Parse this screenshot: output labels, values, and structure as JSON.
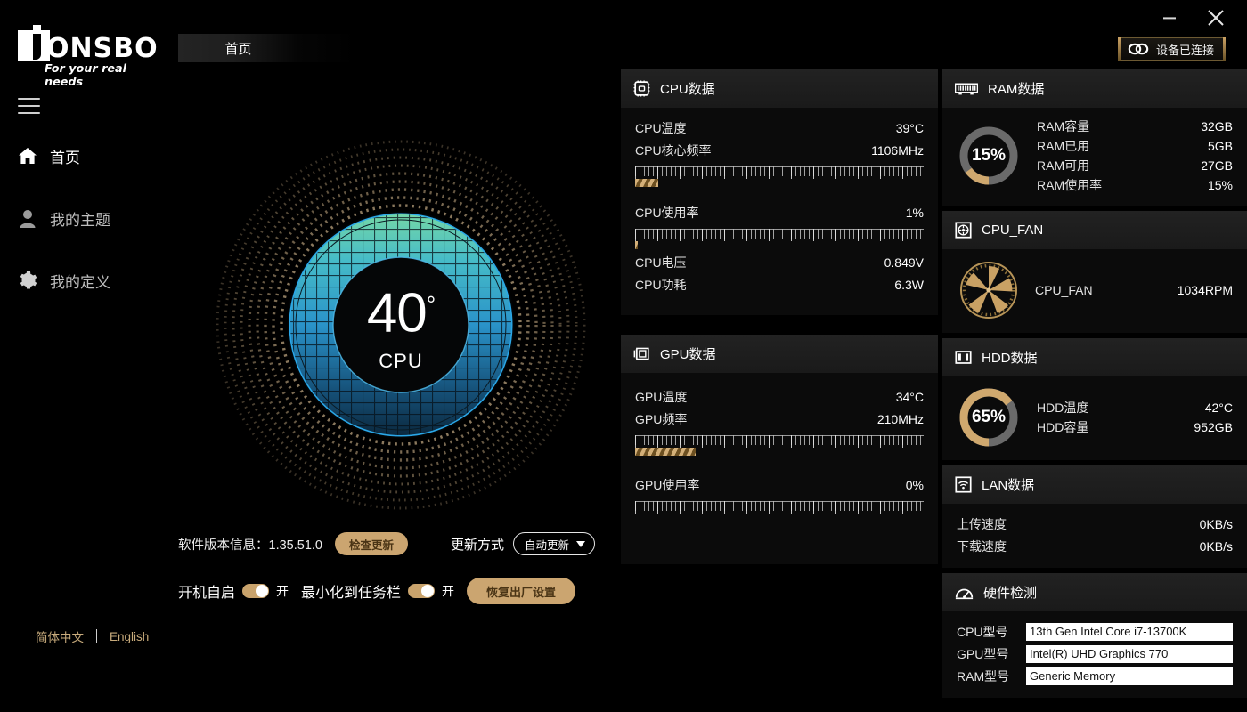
{
  "window": {
    "minimize_label": "minimize",
    "close_label": "close"
  },
  "brand": {
    "name": "ONSBO",
    "tagline": "For your real needs"
  },
  "connection": {
    "status_text": "设备已连接",
    "icon": "chain-link-icon"
  },
  "tabs": [
    {
      "label": "首页",
      "active": true
    }
  ],
  "sidebar": {
    "items": [
      {
        "label": "首页",
        "icon": "home-icon",
        "active": true
      },
      {
        "label": "我的主题",
        "icon": "user-icon",
        "active": false
      },
      {
        "label": "我的定义",
        "icon": "gear-icon",
        "active": false
      }
    ],
    "languages": [
      {
        "label": "简体中文"
      },
      {
        "label": "English"
      }
    ]
  },
  "gauge": {
    "value": "40",
    "degree_symbol": "°",
    "label": "CPU",
    "ring_color": "#2aa7e8",
    "mesh_top_color": "#6fd6a8"
  },
  "settings": {
    "version_label": "软件版本信息：1.35.51.0",
    "check_update_label": "检查更新",
    "update_mode_label": "更新方式",
    "update_mode_value": "自动更新",
    "autostart_label": "开机自启",
    "autostart_state": "开",
    "minimize_tray_label": "最小化到任务栏",
    "minimize_tray_state": "开",
    "restore_label": "恢复出厂设置",
    "accent_gold": "#cba570"
  },
  "panels": {
    "cpu": {
      "title": "CPU数据",
      "icon": "cpu-chip-icon",
      "rows": [
        {
          "key": "CPU温度",
          "value": "39°C"
        },
        {
          "key": "CPU核心频率",
          "value": "1106MHz"
        }
      ],
      "meter1_pct": 8,
      "rows2": [
        {
          "key": "CPU使用率",
          "value": "1%"
        }
      ],
      "meter2_pct": 1,
      "rows3": [
        {
          "key": "CPU电压",
          "value": "0.849V"
        },
        {
          "key": "CPU功耗",
          "value": "6.3W"
        }
      ]
    },
    "gpu": {
      "title": "GPU数据",
      "icon": "gpu-card-icon",
      "rows": [
        {
          "key": "GPU温度",
          "value": "34°C"
        },
        {
          "key": "GPU频率",
          "value": "210MHz"
        }
      ],
      "meter1_pct": 21,
      "rows2": [
        {
          "key": "GPU使用率",
          "value": "0%"
        }
      ],
      "meter2_pct": 0
    },
    "ram": {
      "title": "RAM数据",
      "icon": "ram-stick-icon",
      "donut_pct": 15,
      "donut_text": "15%",
      "donut_fill": "#cfa86e",
      "donut_track": "#6a6a6a",
      "rows": [
        {
          "key": "RAM容量",
          "value": "32GB"
        },
        {
          "key": "RAM已用",
          "value": "5GB"
        },
        {
          "key": "RAM可用",
          "value": "27GB"
        },
        {
          "key": "RAM使用率",
          "value": "15%"
        }
      ]
    },
    "cpu_fan": {
      "title": "CPU_FAN",
      "icon": "fan-square-icon",
      "rows": [
        {
          "key": "CPU_FAN",
          "value": "1034RPM"
        }
      ]
    },
    "hdd": {
      "title": "HDD数据",
      "icon": "hdd-icon",
      "donut_pct": 65,
      "donut_text": "65%",
      "donut_fill": "#cfa86e",
      "donut_track": "#6a6a6a",
      "rows": [
        {
          "key": "HDD温度",
          "value": "42°C"
        },
        {
          "key": "HDD容量",
          "value": "952GB"
        }
      ]
    },
    "lan": {
      "title": "LAN数据",
      "icon": "wifi-icon",
      "rows": [
        {
          "key": "上传速度",
          "value": "0KB/s"
        },
        {
          "key": "下载速度",
          "value": "0KB/s"
        }
      ]
    },
    "hardware": {
      "title": "硬件检测",
      "icon": "gauge-meter-icon",
      "rows": [
        {
          "key": "CPU型号",
          "value": "13th Gen Intel Core i7-13700K"
        },
        {
          "key": "GPU型号",
          "value": "Intel(R) UHD Graphics 770"
        },
        {
          "key": "RAM型号",
          "value": "Generic Memory"
        }
      ]
    }
  }
}
